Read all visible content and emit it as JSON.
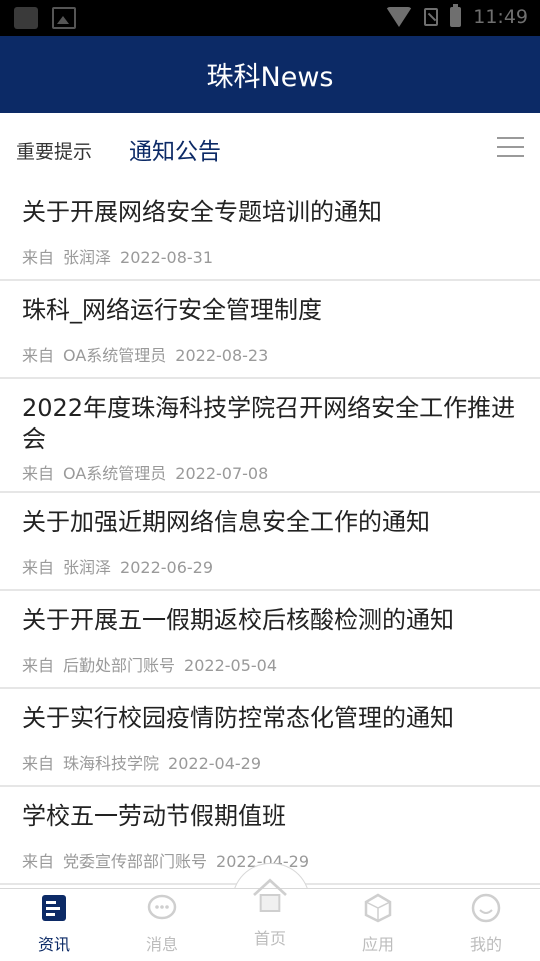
{
  "statusbar": {
    "time": "11:49"
  },
  "header": {
    "title": "珠科News"
  },
  "tabs": [
    {
      "label": "重要提示"
    },
    {
      "label": "通知公告"
    }
  ],
  "news": [
    {
      "title": "关于开展网络安全专题培训的通知",
      "from_label": "来自",
      "author": "张润泽",
      "date": "2022-08-31"
    },
    {
      "title": "珠科_网络运行安全管理制度",
      "from_label": "来自",
      "author": "OA系统管理员",
      "date": "2022-08-23"
    },
    {
      "title": "2022年度珠海科技学院召开网络安全工作推进会",
      "from_label": "来自",
      "author": "OA系统管理员",
      "date": "2022-07-08"
    },
    {
      "title": "关于加强近期网络信息安全工作的通知",
      "from_label": "来自",
      "author": "张润泽",
      "date": "2022-06-29"
    },
    {
      "title": "关于开展五一假期返校后核酸检测的通知",
      "from_label": "来自",
      "author": "后勤处部门账号",
      "date": "2022-05-04"
    },
    {
      "title": "关于实行校园疫情防控常态化管理的通知",
      "from_label": "来自",
      "author": "珠海科技学院",
      "date": "2022-04-29"
    },
    {
      "title": "学校五一劳动节假期值班",
      "from_label": "来自",
      "author": "党委宣传部部门账号",
      "date": "2022-04-29"
    }
  ],
  "nav": [
    {
      "label": "资讯",
      "icon": "news-icon",
      "active": true
    },
    {
      "label": "消息",
      "icon": "message-icon"
    },
    {
      "label": "首页",
      "icon": "home-icon"
    },
    {
      "label": "应用",
      "icon": "apps-icon"
    },
    {
      "label": "我的",
      "icon": "profile-icon"
    }
  ],
  "colors": {
    "primary": "#0c2a66",
    "inactive": "#bdbdbd"
  }
}
